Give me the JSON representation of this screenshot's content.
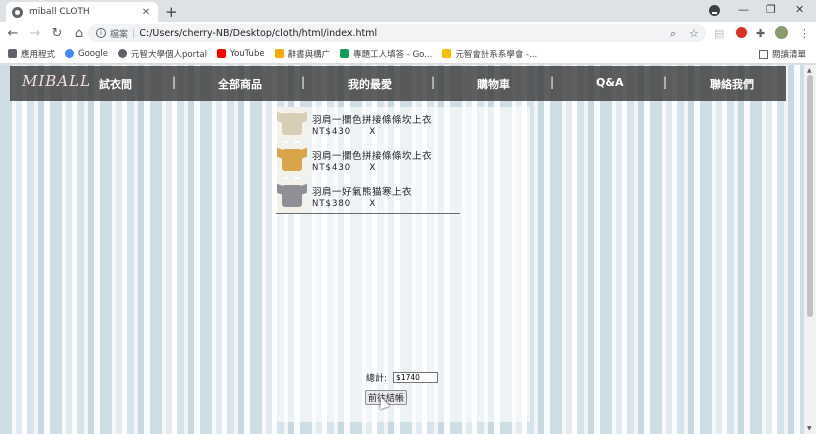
{
  "browser": {
    "tab_title": "miball CLOTH",
    "tab_close": "✕",
    "new_tab": "+",
    "window_controls": {
      "minimize": "—",
      "restore": "❐",
      "close": "✕"
    },
    "url_scheme": "檔案",
    "url": "C:/Users/cherry-NB/Desktop/cloth/html/index.html",
    "bookmarks": [
      {
        "label": "應用程式",
        "icon": "apps-grid-icon",
        "color": "#5f6368"
      },
      {
        "label": "Google",
        "icon": "google-icon",
        "color": "#4285f4"
      },
      {
        "label": "元智大學個人portal",
        "icon": "globe-icon",
        "color": "#5f6368"
      },
      {
        "label": "YouTube",
        "icon": "youtube-icon",
        "color": "#ff0000"
      },
      {
        "label": "辭書與構广",
        "icon": "folder-icon",
        "color": "#f9ab00"
      },
      {
        "label": "專題工人填答 - Go...",
        "icon": "sheets-icon",
        "color": "#0f9d58"
      },
      {
        "label": "元智會計系系學會 -...",
        "icon": "drive-icon",
        "color": "#fbbc04"
      }
    ],
    "reading_list": "閱讀清單"
  },
  "site": {
    "logo": "MIBALL",
    "nav": [
      "試衣間",
      "全部商品",
      "我的最愛",
      "購物車",
      "Q&A",
      "聯絡我們"
    ],
    "nav_separator": "|"
  },
  "cart": {
    "items": [
      {
        "name": "羽肩一攔色拼接條條坎上衣",
        "price": "NT$430",
        "remove": "X",
        "shirt_color": "#d8cdb5"
      },
      {
        "name": "羽肩一攔色拼接條條坎上衣",
        "price": "NT$430",
        "remove": "X",
        "shirt_color": "#d9a54a"
      },
      {
        "name": "羽肩一好氣熊猫寒上衣",
        "price": "NT$380",
        "remove": "X",
        "shirt_color": "#8e9096"
      }
    ],
    "total_label": "總計:",
    "total_value": "$1740",
    "checkout_label": "前往結帳"
  }
}
